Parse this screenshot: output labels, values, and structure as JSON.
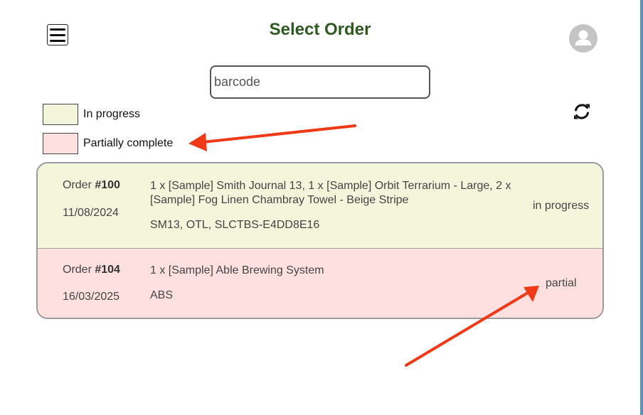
{
  "colors": {
    "title": "#2e5a1f",
    "in_progress": "#f4f6dc",
    "partially_complete": "#ffe0e0",
    "annotation_arrow": "#f03a17",
    "right_edge": "#5b93b6"
  },
  "header": {
    "menu_icon": "hamburger-icon",
    "title": "Select Order",
    "avatar_icon": "user-icon"
  },
  "search": {
    "placeholder": "barcode",
    "value": ""
  },
  "legend": [
    {
      "label": "In progress",
      "color": "#f4f6dc"
    },
    {
      "label": "Partially complete",
      "color": "#ffe0e0"
    }
  ],
  "toolbar": {
    "refresh_icon": "refresh-icon"
  },
  "orders": [
    {
      "label": "Order",
      "number": "#100",
      "date": "11/08/2024",
      "items": "1 x [Sample] Smith Journal 13, 1 x [Sample] Orbit Terrarium - Large, 2 x [Sample] Fog Linen Chambray Towel - Beige Stripe",
      "skus": "SM13, OTL, SLCTBS-E4DD8E16",
      "status": "in progress"
    },
    {
      "label": "Order",
      "number": "#104",
      "date": "16/03/2025",
      "items": "1 x [Sample] Able Brewing System",
      "skus": "ABS",
      "status": "partial"
    }
  ]
}
